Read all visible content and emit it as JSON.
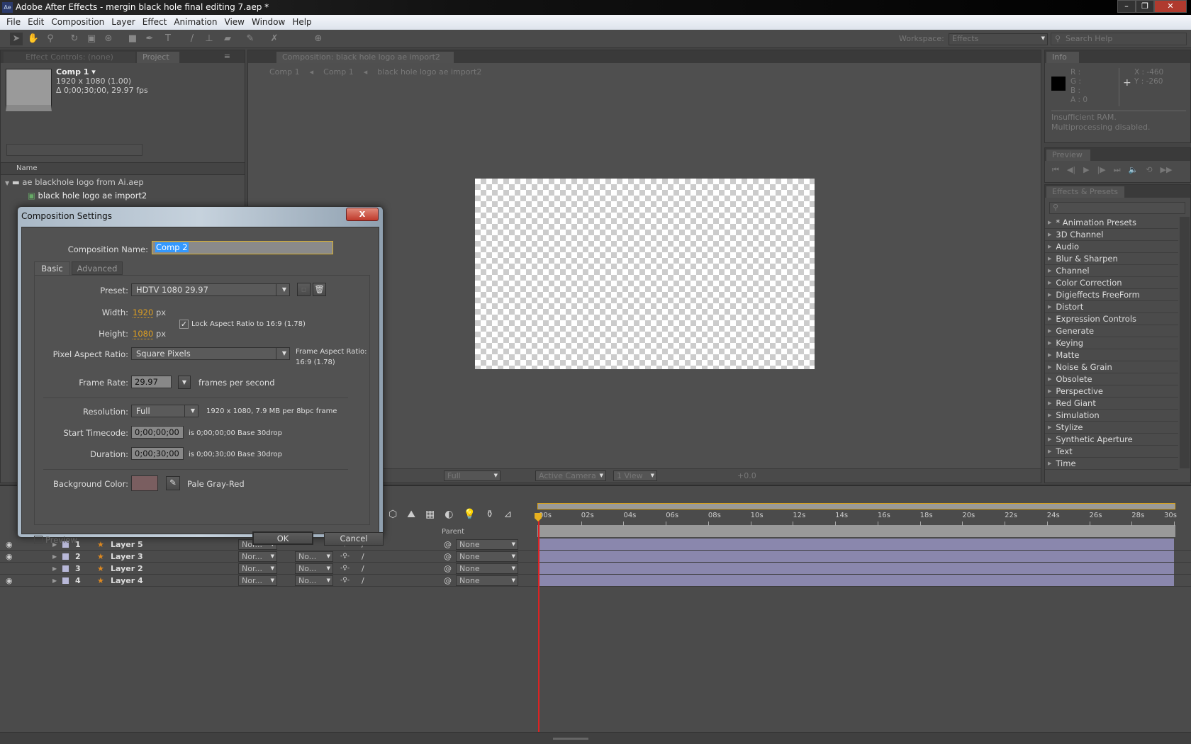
{
  "window": {
    "title": "Adobe After Effects - mergin black hole final editing 7.aep *",
    "logo": "Ae",
    "controls": [
      "minimize-icon",
      "restore-icon",
      "close-icon"
    ]
  },
  "menu": [
    "File",
    "Edit",
    "Composition",
    "Layer",
    "Effect",
    "Animation",
    "View",
    "Window",
    "Help"
  ],
  "toolbar": {
    "workspace_label": "Workspace:",
    "workspace_value": "Effects",
    "search_placeholder": "Search Help"
  },
  "left_panel": {
    "tabs": [
      "Effect Controls: (none)",
      "Project"
    ],
    "comp_name": "Comp 1 ▾",
    "comp_size": "1920 x 1080 (1.00)",
    "comp_duration": "Δ 0;00;30;00, 29.97 fps",
    "column_name": "Name",
    "items": [
      {
        "name": "ae blackhole logo from Ai.aep",
        "type": "folder"
      },
      {
        "name": "black hole logo ae import2",
        "type": "composition"
      }
    ]
  },
  "comp_panel": {
    "tab": "Composition: black hole logo ae import2",
    "breadcrumbs": [
      "Comp 1",
      "Comp 1",
      "black hole logo ae import2"
    ],
    "footer": {
      "resolution": "Full",
      "camera": "Active Camera",
      "views": "1 View",
      "exposure": "+0.0"
    }
  },
  "info_panel": {
    "tab": "Info",
    "r": "R :",
    "g": "G :",
    "b": "B :",
    "a": "A : 0",
    "x": "X : -460",
    "y": "Y : -260",
    "message1": "Insufficient RAM.",
    "message2": "Multiprocessing disabled."
  },
  "preview_panel": {
    "tab": "Preview"
  },
  "effects_panel": {
    "tab": "Effects & Presets",
    "items": [
      "* Animation Presets",
      "3D Channel",
      "Audio",
      "Blur & Sharpen",
      "Channel",
      "Color Correction",
      "Digieffects FreeForm",
      "Distort",
      "Expression Controls",
      "Generate",
      "Keying",
      "Matte",
      "Noise & Grain",
      "Obsolete",
      "Perspective",
      "Red Giant",
      "Simulation",
      "Stylize",
      "Synthetic Aperture",
      "Text",
      "Time"
    ]
  },
  "timeline": {
    "parent_header": "Parent",
    "ticks": [
      "00s",
      "02s",
      "04s",
      "06s",
      "08s",
      "10s",
      "12s",
      "14s",
      "16s",
      "18s",
      "20s",
      "22s",
      "24s",
      "26s",
      "28s",
      "30s"
    ],
    "layers": [
      {
        "num": "1",
        "name": "Layer 5",
        "mode": "Nor...",
        "trkmat": "",
        "parent": "None",
        "visible": true
      },
      {
        "num": "2",
        "name": "Layer 3",
        "mode": "Nor...",
        "trkmat": "No...",
        "parent": "None",
        "visible": true
      },
      {
        "num": "3",
        "name": "Layer 2",
        "mode": "Nor...",
        "trkmat": "No...",
        "parent": "None",
        "visible": false
      },
      {
        "num": "4",
        "name": "Layer 4",
        "mode": "Nor...",
        "trkmat": "No...",
        "parent": "None",
        "visible": true
      }
    ],
    "layer_bar_color": "#8a87ad"
  },
  "dialog": {
    "title": "Composition Settings",
    "close": "X",
    "name_label": "Composition Name:",
    "name_value": "Comp 2",
    "tabs": [
      "Basic",
      "Advanced"
    ],
    "preset_label": "Preset:",
    "preset_value": "HDTV 1080 29.97",
    "width_label": "Width:",
    "width_value": "1920",
    "height_label": "Height:",
    "height_value": "1080",
    "px": "px",
    "lock_label": "Lock Aspect Ratio to 16:9 (1.78)",
    "lock_checked": true,
    "par_label": "Pixel Aspect Ratio:",
    "par_value": "Square Pixels",
    "far_label": "Frame Aspect Ratio:",
    "far_value": "16:9 (1.78)",
    "fps_label": "Frame Rate:",
    "fps_value": "29.97",
    "fps_unit": "frames per second",
    "res_label": "Resolution:",
    "res_value": "Full",
    "res_info": "1920 x 1080, 7.9 MB per 8bpc frame",
    "start_label": "Start Timecode:",
    "start_value": "0;00;00;00",
    "start_info": "is 0;00;00;00  Base 30drop",
    "dur_label": "Duration:",
    "dur_value": "0;00;30;00",
    "dur_info": "is 0;00;30;00  Base 30drop",
    "bg_label": "Background Color:",
    "bg_color": "#7a5e60",
    "bg_name": "Pale Gray-Red",
    "preview_label": "Preview",
    "ok": "OK",
    "cancel": "Cancel"
  }
}
